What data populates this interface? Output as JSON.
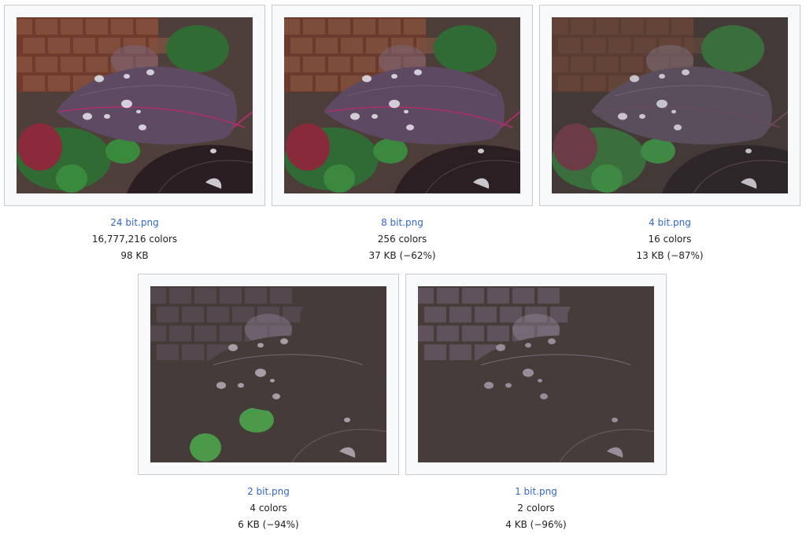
{
  "items": [
    {
      "file_label": "24 bit.png",
      "colors_label": "16,777,216 colors",
      "size_label": "98 KB",
      "palette": {
        "bg": "#4f3f3a",
        "brick": "#6e3b2c",
        "brick2": "#8a5a44",
        "leaf": "#5e4b63",
        "leaf_light": "#7a6780",
        "vein": "#b0306a",
        "green": "#3a8a3e",
        "green2": "#2f6b33",
        "red": "#8a2a3a",
        "drop": "#e8e6ee",
        "dark": "#2a1e22"
      }
    },
    {
      "file_label": "8 bit.png",
      "colors_label": "256 colors",
      "size_label": "37 KB (−62%)",
      "palette": {
        "bg": "#4d3d38",
        "brick": "#6b3a2c",
        "brick2": "#875a45",
        "leaf": "#5d4a62",
        "leaf_light": "#79667f",
        "vein": "#ad2f68",
        "green": "#3b893e",
        "green2": "#306a34",
        "red": "#882a3a",
        "drop": "#e6e4ec",
        "dark": "#2b1f23"
      }
    },
    {
      "file_label": "4 bit.png",
      "colors_label": "16 colors",
      "size_label": "13 KB (−87%)",
      "palette": {
        "bg": "#433a37",
        "brick": "#5b3c33",
        "brick2": "#6b4a3e",
        "leaf": "#5a4d5c",
        "leaf_light": "#7e6f80",
        "vein": "#6a4a5e",
        "green": "#3f8a43",
        "green2": "#3a6e3c",
        "red": "#6b3c45",
        "drop": "#dcd8e0",
        "dark": "#2d2729"
      }
    },
    {
      "file_label": "2 bit.png",
      "colors_label": "4 colors",
      "size_label": "6 KB (−94%)",
      "palette": {
        "bg": "#453c3a",
        "brick": "#453c3a",
        "brick2": "#5f4f5c",
        "leaf": "#453c3a",
        "leaf_light": "#8a7a8c",
        "vein": "#453c3a",
        "green": "#4a9a4a",
        "green2": "#453c3a",
        "red": "#453c3a",
        "drop": "#b8aebb",
        "dark": "#453c3a"
      }
    },
    {
      "file_label": "1 bit.png",
      "colors_label": "2 colors",
      "size_label": "4 KB (−96%)",
      "palette": {
        "bg": "#463d3b",
        "brick": "#463d3b",
        "brick2": "#6f6170",
        "leaf": "#463d3b",
        "leaf_light": "#8e7f92",
        "vein": "#463d3b",
        "green": "#463d3b",
        "green2": "#463d3b",
        "red": "#463d3b",
        "drop": "#a89aac",
        "dark": "#463d3b"
      }
    }
  ]
}
